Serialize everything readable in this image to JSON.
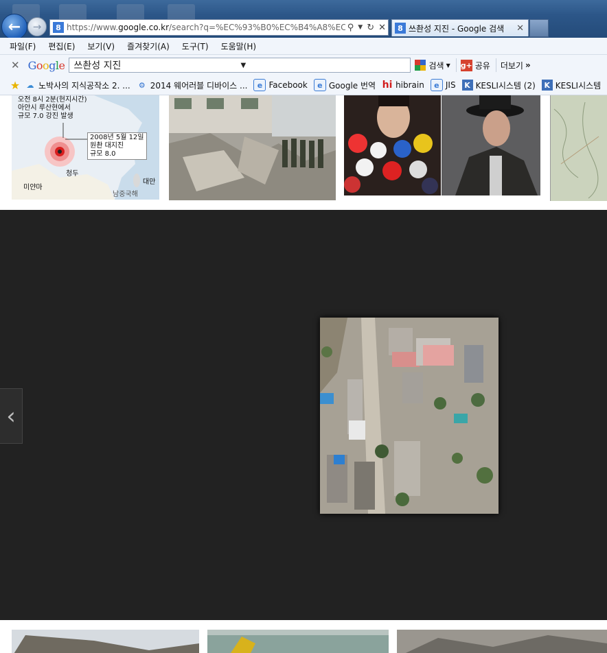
{
  "browser": {
    "address_url_prefix": "https://www.",
    "address_url_domain": "google.co.kr",
    "address_url_rest": "/search?q=%EC%93%B0%EC%B4%A8%EC%84%",
    "tab_title": "쓰촨성 지진 - Google 검색"
  },
  "menu": [
    "파일(F)",
    "편집(E)",
    "보기(V)",
    "즐겨찾기(A)",
    "도구(T)",
    "도움말(H)"
  ],
  "google_toolbar": {
    "logo": "Google",
    "query": "쓰촨성 지진",
    "search_label": "검색",
    "share_label": "공유",
    "more_label": "더보기"
  },
  "favorites": [
    {
      "label": "노박사의 지식공작소  2. ...",
      "icon": "folder-star-icon"
    },
    {
      "label": "2014 웨어러블 디바이스 ...",
      "icon": "web-slice-icon"
    },
    {
      "label": "Facebook",
      "icon": "ie-page-icon"
    },
    {
      "label": "Google 번역",
      "icon": "ie-page-icon"
    },
    {
      "label": "hibrain",
      "icon": "hi-icon"
    },
    {
      "label": "JIS",
      "icon": "ie-page-icon"
    },
    {
      "label": "KESLI시스템 (2)",
      "icon": "k-icon"
    },
    {
      "label": "KESLI시스템",
      "icon": "k-icon"
    }
  ],
  "map_thumbnail": {
    "note1": [
      "오전 8시 2분(현지시간)",
      "아안시 루산현에서",
      "규모 7.0 강진 발생"
    ],
    "note2": [
      "2008년  5월  12일",
      "원촨  대지진",
      "규모 8.0"
    ],
    "city": "청두",
    "country": "미얀마",
    "island": "대만",
    "source": "남중국해"
  }
}
